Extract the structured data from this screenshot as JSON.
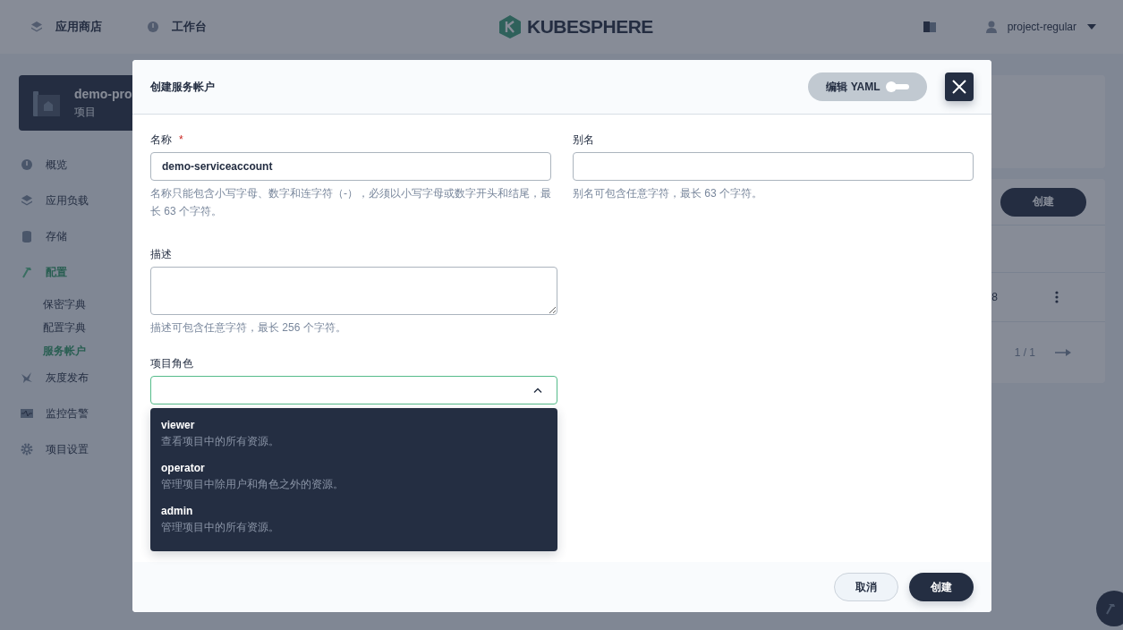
{
  "top_nav": {
    "items": [
      {
        "label": "应用商店"
      },
      {
        "label": "工作台"
      }
    ],
    "logo": "KUBESPHERE",
    "user": "project-regular"
  },
  "project_card": {
    "name": "demo-pro",
    "type": "项目"
  },
  "sidebar": {
    "items": [
      {
        "label": "概览",
        "selected": false
      },
      {
        "label": "应用负载",
        "selected": false
      },
      {
        "label": "存储",
        "selected": false
      },
      {
        "label": "配置",
        "selected": true,
        "children": [
          {
            "label": "保密字典",
            "selected": false
          },
          {
            "label": "配置字典",
            "selected": false
          },
          {
            "label": "服务帐户",
            "selected": true
          }
        ]
      },
      {
        "label": "灰度发布",
        "selected": false
      },
      {
        "label": "监控告警",
        "selected": false
      },
      {
        "label": "项目设置",
        "selected": false
      }
    ]
  },
  "content": {
    "create_button": "创建",
    "cell_fragment": "8",
    "pagination": "1 / 1"
  },
  "dialog": {
    "title": "创建服务帐户",
    "yaml_toggle": {
      "label": "编辑 YAML",
      "on": false
    },
    "fields": [
      {
        "label": "名称",
        "required_mark": "*",
        "value": "demo-serviceaccount",
        "hint": "名称只能包含小写字母、数字和连字符（-），必须以小写字母或数字开头和结尾，最长 63 个字符。"
      },
      {
        "label": "别名",
        "hint": "别名可包含任意字符，最长 63 个字符。"
      },
      {
        "label": "描述",
        "hint": "描述可包含任意字符，最长 256 个字符。"
      }
    ],
    "role_select": {
      "label": "项目角色",
      "expanded": true,
      "options": [
        {
          "name": "viewer",
          "description": "查看项目中的所有资源。"
        },
        {
          "name": "operator",
          "description": "管理项目中除用户和角色之外的资源。"
        },
        {
          "name": "admin",
          "description": "管理项目中的所有资源。"
        }
      ]
    },
    "buttons": {
      "cancel": "取消",
      "submit": "创建"
    }
  }
}
